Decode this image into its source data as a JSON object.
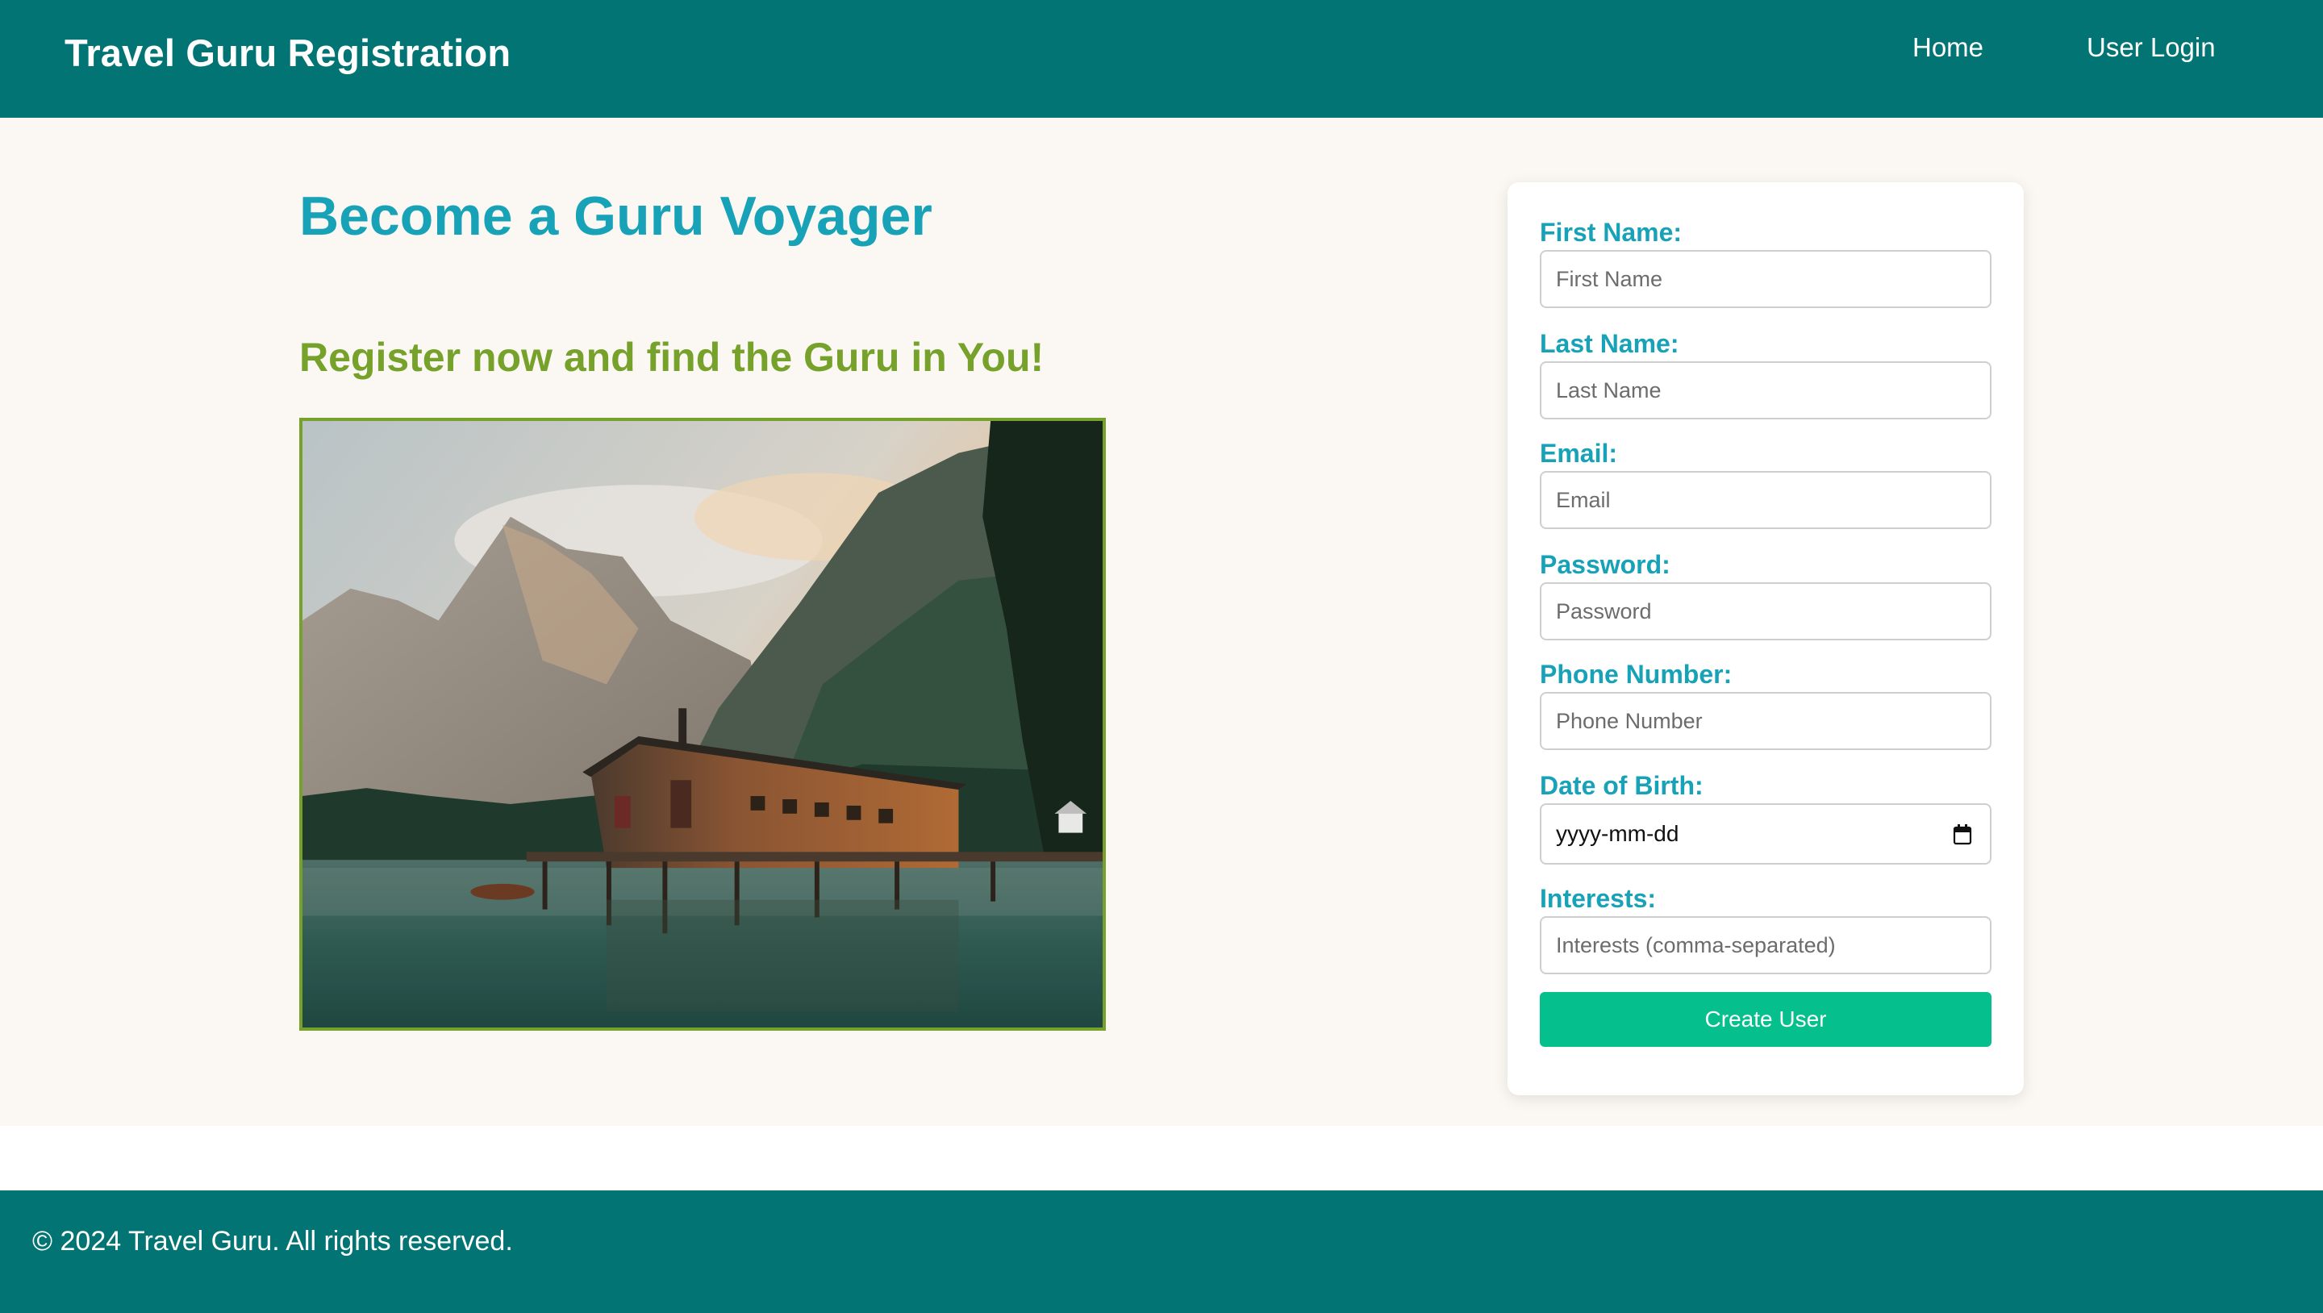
{
  "header": {
    "title": "Travel Guru Registration",
    "nav": [
      {
        "label": "Home"
      },
      {
        "label": "User Login"
      }
    ]
  },
  "hero": {
    "title": "Become a Guru Voyager",
    "subtitle": "Register now and find the Guru in You!",
    "image_icon": "lake-boathouse-photo"
  },
  "form": {
    "fields": [
      {
        "label": "First Name:",
        "placeholder": "First Name",
        "value": ""
      },
      {
        "label": "Last Name:",
        "placeholder": "Last Name",
        "value": ""
      },
      {
        "label": "Email:",
        "placeholder": "Email",
        "value": ""
      },
      {
        "label": "Password:",
        "placeholder": "Password",
        "value": ""
      },
      {
        "label": "Phone Number:",
        "placeholder": "Phone Number",
        "value": ""
      },
      {
        "label": "Date of Birth:",
        "placeholder": "yyyy-mm-dd",
        "value": ""
      },
      {
        "label": "Interests:",
        "placeholder": "Interests (comma-separated)",
        "value": ""
      }
    ],
    "submit_label": "Create User",
    "date_icon": "calendar-icon"
  },
  "footer": {
    "text": "© 2024 Travel Guru. All rights reserved."
  },
  "colors": {
    "header_bg": "#037474",
    "accent_label": "#17a2b8",
    "subtitle_green": "#76a22b",
    "button": "#05bf8c",
    "page_bg": "#fbf7f2"
  }
}
